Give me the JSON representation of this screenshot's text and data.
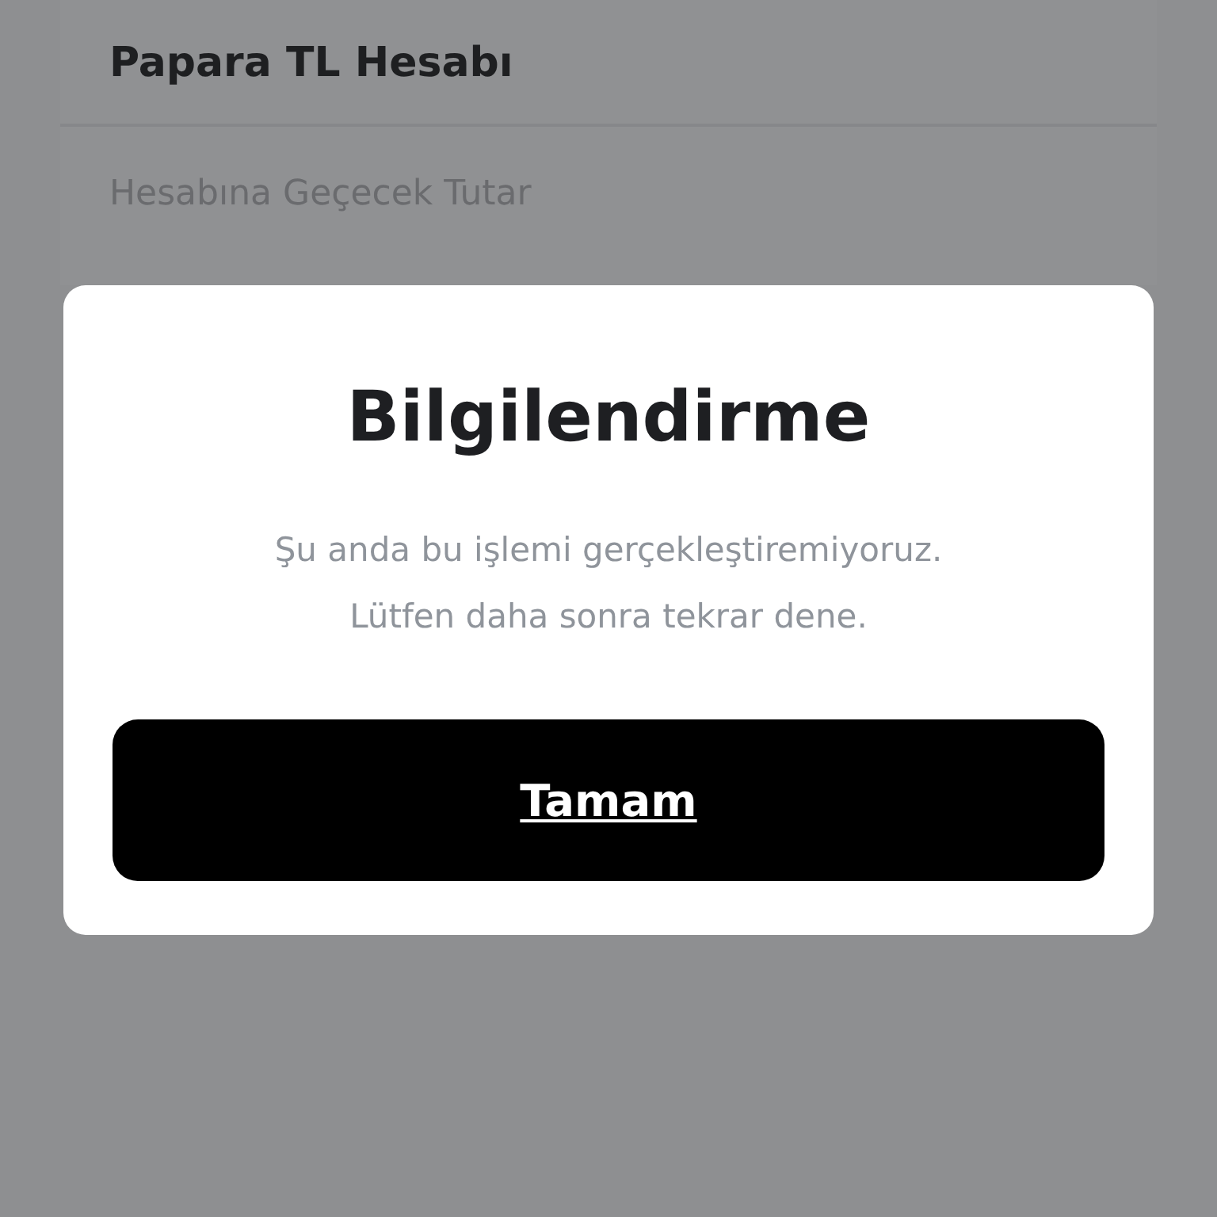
{
  "background_form": {
    "fields": [
      {
        "value": "Papara TL Hesabı"
      },
      {
        "label": "Hesabına Geçecek Tutar"
      }
    ]
  },
  "dialog": {
    "title": "Bilgilendirme",
    "message_lines": [
      "Şu anda bu işlemi gerçekleştiremiyoruz.",
      "Lütfen daha sonra tekrar dene."
    ],
    "button": "Tamam"
  }
}
